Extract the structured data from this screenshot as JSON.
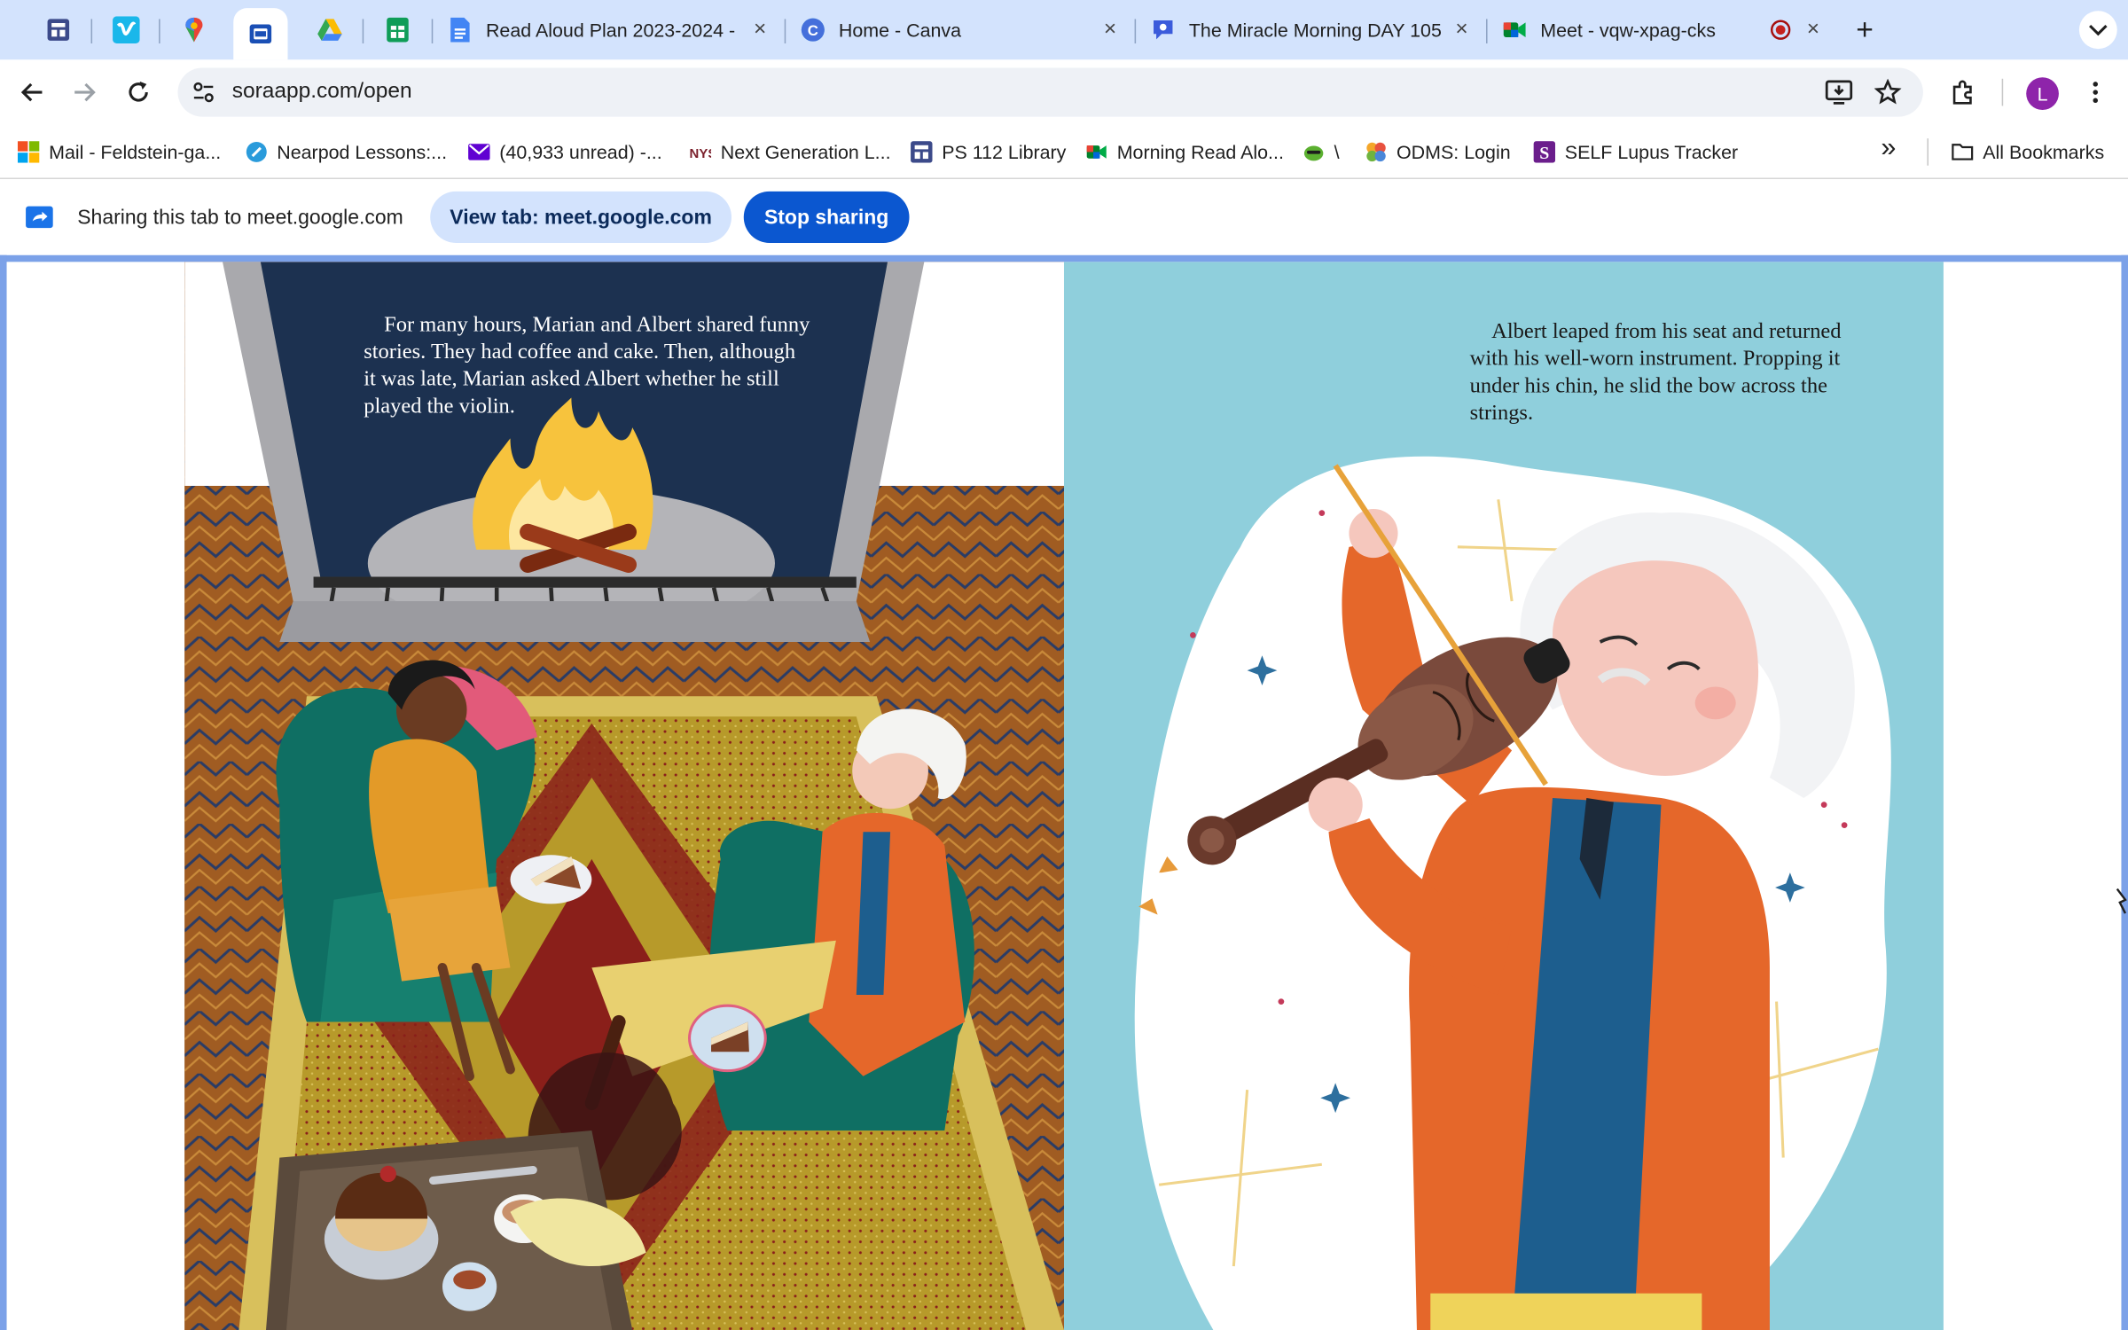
{
  "browser": {
    "tabs": [
      {
        "title": "Read Aloud Plan 2023-2024 -"
      },
      {
        "title": "Home - Canva"
      },
      {
        "title": "The Miracle Morning DAY 105"
      },
      {
        "title": "Meet - vqw-xpag-cks"
      }
    ],
    "new_tab_symbol": "+",
    "close_symbol": "×",
    "address": "soraapp.com/open",
    "profile_initial": "L",
    "bookmarks": [
      {
        "label": "Mail - Feldstein-ga..."
      },
      {
        "label": "Nearpod Lessons:..."
      },
      {
        "label": "(40,933 unread) -..."
      },
      {
        "label": "Next Generation L..."
      },
      {
        "label": "PS 112 Library"
      },
      {
        "label": "Morning Read Alo..."
      },
      {
        "label": "\\"
      },
      {
        "label": "ODMS: Login"
      },
      {
        "label": "SELF Lupus Tracker"
      }
    ],
    "more_bookmarks_symbol": "»",
    "all_bookmarks": "All Bookmarks"
  },
  "share_bar": {
    "message": "Sharing this tab to meet.google.com",
    "view_button": "View tab: meet.google.com",
    "stop_button": "Stop sharing"
  },
  "book": {
    "left_page_text": "For many hours, Marian and Albert shared funny stories. They had coffee and cake. Then, although it was late, Marian asked Albert whether he still played the violin.",
    "right_page_text": "Albert leaped from his seat and returned with his well-worn instrument. Propping it under his chin, he slid the bow across the strings."
  },
  "colors": {
    "tab_strip": "#d3e3fd",
    "accent_blue": "#0b57d0",
    "share_border": "#7ba1e8",
    "right_page_sky": "#8fcfdc"
  },
  "icons": {
    "pinned_tabs": [
      "sheets-app-icon",
      "vimeo-icon",
      "maps-pin-icon",
      "sora-reader-icon",
      "drive-icon",
      "sheets-icon"
    ],
    "nav": [
      "back-icon",
      "forward-icon",
      "reload-icon",
      "site-info-icon"
    ],
    "right_toolbar": [
      "install-app-icon",
      "bookmark-star-icon",
      "extensions-icon",
      "avatar",
      "menu-kebab-icon"
    ]
  }
}
